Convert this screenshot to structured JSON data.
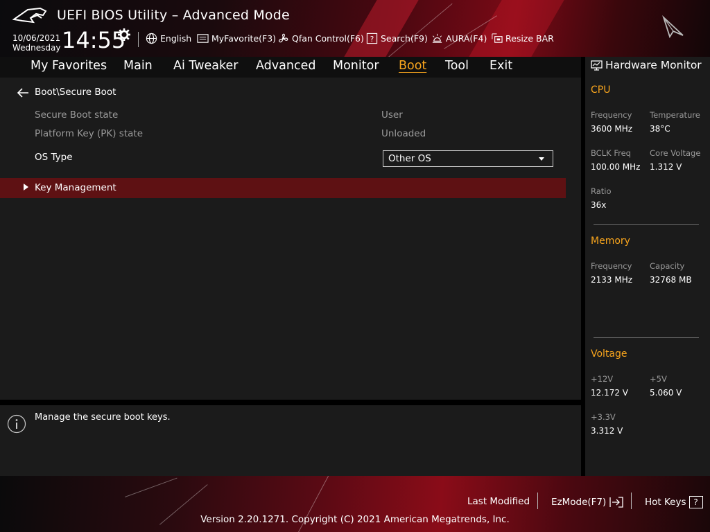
{
  "header": {
    "title": "UEFI BIOS Utility – Advanced Mode",
    "date": "10/06/2021",
    "weekday": "Wednesday",
    "time": "14:55",
    "toolbar": [
      {
        "label": "English",
        "icon": "globe-icon"
      },
      {
        "label": "MyFavorite(F3)",
        "icon": "favorite-list-icon"
      },
      {
        "label": "Qfan Control(F6)",
        "icon": "fan-icon"
      },
      {
        "label": "Search(F9)",
        "icon": "search-help-icon"
      },
      {
        "label": "AURA(F4)",
        "icon": "aura-light-icon"
      },
      {
        "label": "Resize BAR",
        "icon": "resize-bar-icon"
      }
    ]
  },
  "nav": {
    "tabs": [
      "My Favorites",
      "Main",
      "Ai Tweaker",
      "Advanced",
      "Monitor",
      "Boot",
      "Tool",
      "Exit"
    ],
    "active": "Boot"
  },
  "main": {
    "breadcrumb": "Boot\\Secure Boot",
    "rows": [
      {
        "label": "Secure Boot state",
        "value": "User"
      },
      {
        "label": "Platform Key (PK) state",
        "value": "Unloaded"
      }
    ],
    "os_type": {
      "label": "OS Type",
      "value": "Other OS"
    },
    "submenu": {
      "label": "Key Management"
    }
  },
  "help": {
    "text": "Manage the secure boot keys."
  },
  "hardware_monitor": {
    "title": "Hardware Monitor",
    "cpu": {
      "title": "CPU",
      "frequency_label": "Frequency",
      "frequency": "3600 MHz",
      "temperature_label": "Temperature",
      "temperature": "38°C",
      "bclk_label": "BCLK Freq",
      "bclk": "100.00 MHz",
      "core_voltage_label": "Core Voltage",
      "core_voltage": "1.312 V",
      "ratio_label": "Ratio",
      "ratio": "36x"
    },
    "memory": {
      "title": "Memory",
      "frequency_label": "Frequency",
      "frequency": "2133 MHz",
      "capacity_label": "Capacity",
      "capacity": "32768 MB"
    },
    "voltage": {
      "title": "Voltage",
      "v12_label": "+12V",
      "v12": "12.172 V",
      "v5_label": "+5V",
      "v5": "5.060 V",
      "v33_label": "+3.3V",
      "v33": "3.312 V"
    }
  },
  "footer": {
    "last_modified": "Last Modified",
    "ezmode": "EzMode(F7)",
    "hotkeys": "Hot Keys",
    "hotkeys_glyph": "?",
    "version": "Version 2.20.1271. Copyright (C) 2021 American Megatrends, Inc."
  },
  "colors": {
    "accent": "#f7a41d",
    "highlight_row": "#5e1113",
    "panel": "#1b1b1b"
  }
}
